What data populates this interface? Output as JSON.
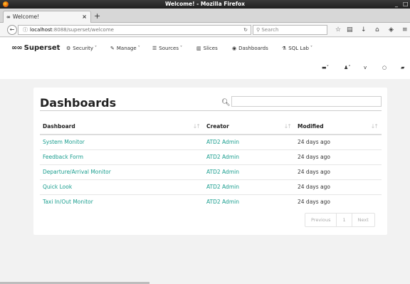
{
  "window": {
    "title": "Welcome! - Mozilla Firefox",
    "controls": [
      "_",
      "□"
    ]
  },
  "browser": {
    "tab_label": "Welcome!",
    "tab_close": "×",
    "new_tab": "+",
    "url_host": "localhost",
    "url_rest": ":8088/superset/welcome",
    "search_placeholder": "Search"
  },
  "app": {
    "brand": "Superset",
    "menu": [
      {
        "label": "Security",
        "icon": "gear-icon",
        "caret": true
      },
      {
        "label": "Manage",
        "icon": "wrench-icon",
        "caret": true
      },
      {
        "label": "Sources",
        "icon": "database-icon",
        "caret": true
      },
      {
        "label": "Slices",
        "icon": "bar-chart-icon",
        "caret": false
      },
      {
        "label": "Dashboards",
        "icon": "dashboard-icon",
        "caret": false
      },
      {
        "label": "SQL Lab",
        "icon": "flask-icon",
        "caret": true
      }
    ]
  },
  "panel": {
    "title": "Dashboards",
    "search_value": "",
    "columns": [
      "Dashboard",
      "Creator",
      "Modified"
    ],
    "rows": [
      {
        "dashboard": "System Monitor",
        "creator": "ATD2 Admin",
        "modified": "24 days ago"
      },
      {
        "dashboard": "Feedback Form",
        "creator": "ATD2 Admin",
        "modified": "24 days ago"
      },
      {
        "dashboard": "Departure/Arrival Monitor",
        "creator": "ATD2 Admin",
        "modified": "24 days ago"
      },
      {
        "dashboard": "Quick Look",
        "creator": "ATD2 Admin",
        "modified": "24 days ago"
      },
      {
        "dashboard": "Taxi In/Out Monitor",
        "creator": "ATD2 Admin",
        "modified": "24 days ago"
      }
    ],
    "pagination": {
      "previous": "Previous",
      "page": "1",
      "next": "Next"
    }
  }
}
